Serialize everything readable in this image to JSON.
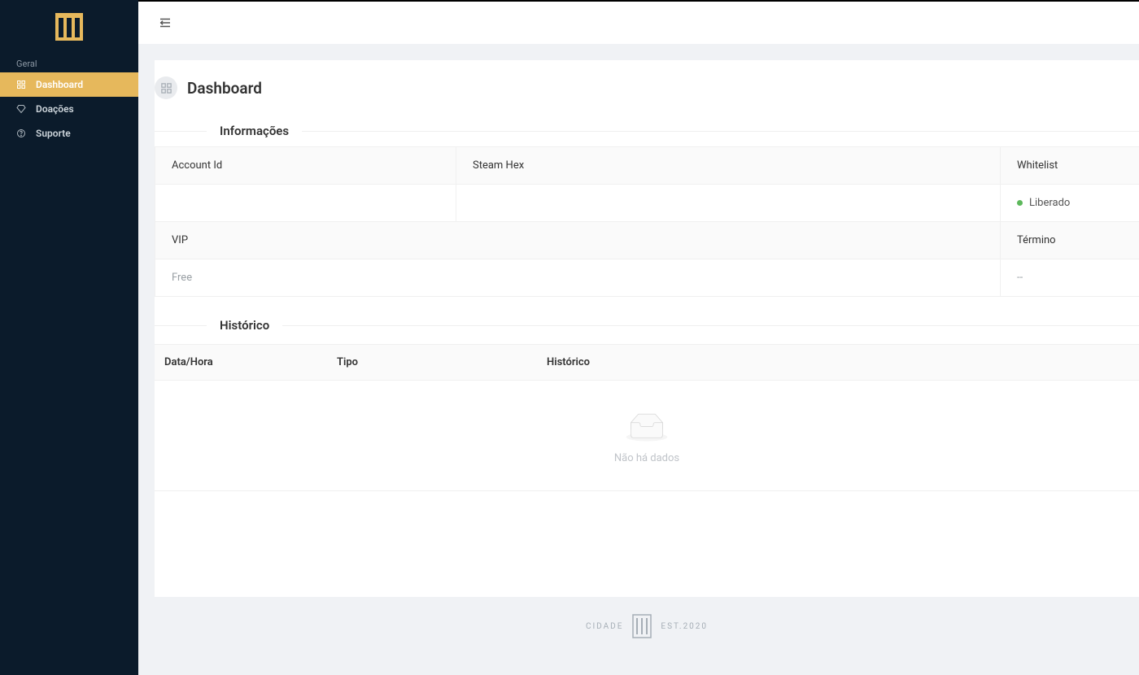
{
  "sidebar": {
    "section_label": "Geral",
    "items": [
      {
        "label": "Dashboard"
      },
      {
        "label": "Doações"
      },
      {
        "label": "Suporte"
      }
    ]
  },
  "page": {
    "title": "Dashboard"
  },
  "informacoes": {
    "title": "Informações",
    "labels": {
      "account_id": "Account Id",
      "steam_hex": "Steam Hex",
      "whitelist": "Whitelist",
      "vip": "VIP",
      "termino": "Término"
    },
    "values": {
      "account_id": "",
      "steam_hex": "",
      "whitelist": "Liberado",
      "vip": "Free",
      "termino": "--"
    }
  },
  "historico": {
    "title": "Histórico",
    "columns": {
      "data_hora": "Data/Hora",
      "tipo": "Tipo",
      "historico": "Histórico"
    },
    "empty_text": "Não há dados"
  },
  "footer": {
    "brand_left": "CIDADE",
    "brand_right": "EST.2020"
  },
  "colors": {
    "accent": "#e6b85c",
    "sidebar_bg": "#0b1b2b",
    "status_green": "#5db85c"
  }
}
